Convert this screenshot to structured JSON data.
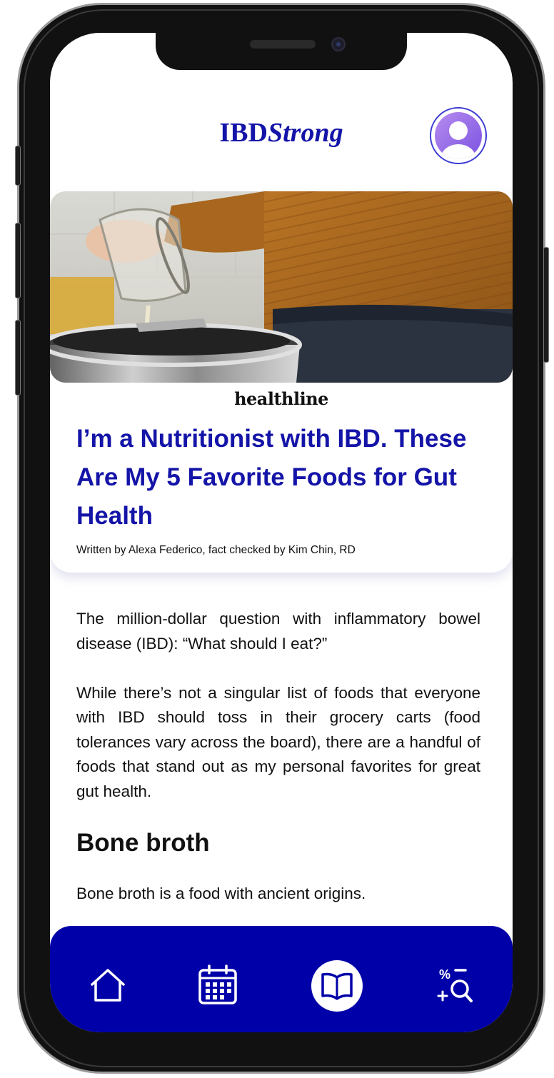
{
  "app": {
    "logo_regular": "IBD",
    "logo_italic": "Strong",
    "brand_color": "#1414A8",
    "nav_color": "#0000A8"
  },
  "header": {
    "profile_icon": "user-avatar-icon"
  },
  "article_card": {
    "hero_image": "person-pouring-liquid-into-pot",
    "source": "healthline",
    "title": "I’m a Nutritionist with IBD. These Are My 5 Favorite Foods for Gut Health",
    "byline": "Written by Alexa Federico, fact checked by Kim Chin, RD"
  },
  "article_body": {
    "paragraph_1": "The million-dollar question with inflammatory bowel disease (IBD): “What should I eat?”",
    "paragraph_2": "While there’s not a singular list of foods that everyone with IBD should toss in their grocery carts (food tolerances vary across the board), there are a handful of foods that stand out as my personal favorites for great gut health.",
    "section_heading": "Bone broth",
    "paragraph_3": "Bone broth is a food with ancient origins."
  },
  "bottom_nav": {
    "items": [
      {
        "icon": "home-icon",
        "active": false
      },
      {
        "icon": "calendar-icon",
        "active": false
      },
      {
        "icon": "book-icon",
        "active": true
      },
      {
        "icon": "calculator-search-icon",
        "active": false
      }
    ]
  }
}
